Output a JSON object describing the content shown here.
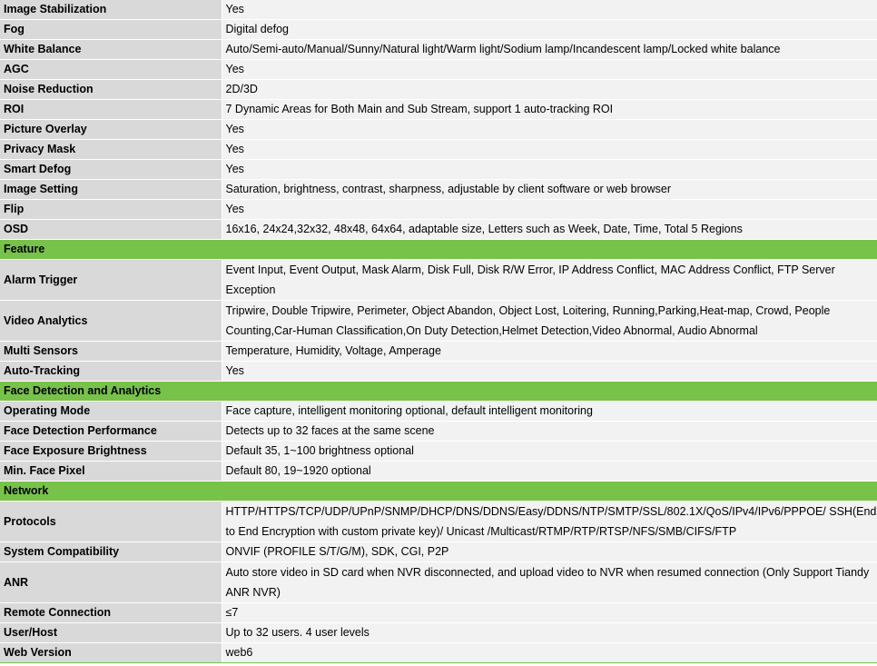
{
  "colors": {
    "section_bg": "#77c248",
    "label_bg": "#d9d9d9",
    "value_bg": "#f2f2f2"
  },
  "rows": [
    {
      "label": "Image Stabilization",
      "value": "Yes"
    },
    {
      "label": "Fog",
      "value": "Digital defog"
    },
    {
      "label": "White Balance",
      "value": "Auto/Semi-auto/Manual/Sunny/Natural light/Warm light/Sodium lamp/Incandescent lamp/Locked white balance"
    },
    {
      "label": "AGC",
      "value": "Yes"
    },
    {
      "label": "Noise Reduction",
      "value": "2D/3D"
    },
    {
      "label": "ROI",
      "value": "7 Dynamic Areas for Both Main and Sub Stream, support 1 auto-tracking ROI"
    },
    {
      "label": "Picture Overlay",
      "value": "Yes"
    },
    {
      "label": "Privacy Mask",
      "value": "Yes"
    },
    {
      "label": "Smart Defog",
      "value": "Yes"
    },
    {
      "label": "Image Setting",
      "value": "Saturation, brightness, contrast, sharpness, adjustable by client software or web browser"
    },
    {
      "label": "Flip",
      "value": "Yes"
    },
    {
      "label": "OSD",
      "value": "16x16, 24x24,32x32, 48x48, 64x64, adaptable size, Letters such as Week, Date, Time, Total 5 Regions"
    },
    {
      "section": "Feature"
    },
    {
      "label": "Alarm Trigger",
      "value": "Event Input, Event Output, Mask Alarm, Disk Full, Disk R/W Error, IP Address Conflict, MAC Address Conflict, FTP Server Exception",
      "tall": true
    },
    {
      "label": "Video Analytics",
      "value": "Tripwire, Double Tripwire, Perimeter, Object  Abandon, Object Lost, Loitering, Running,Parking,Heat-map, Crowd, People Counting,Car-Human Classification,On Duty Detection,Helmet Detection,Video Abnormal, Audio Abnormal",
      "tall": true
    },
    {
      "label": "Multi Sensors",
      "value": "Temperature, Humidity, Voltage, Amperage"
    },
    {
      "label": "Auto-Tracking",
      "value": "Yes"
    },
    {
      "section": "Face Detection and Analytics"
    },
    {
      "label": "Operating Mode",
      "value": "Face capture, intelligent monitoring optional, default intelligent monitoring"
    },
    {
      "label": "Face Detection Performance",
      "value": "Detects up to 32 faces at the same scene"
    },
    {
      "label": "Face Exposure Brightness",
      "value": "Default 35, 1~100 brightness optional"
    },
    {
      "label": "Min. Face Pixel",
      "value": "Default 80, 19~1920 optional"
    },
    {
      "section": "Network"
    },
    {
      "label": "Protocols",
      "value": "HTTP/HTTPS/TCP/UDP/UPnP/SNMP/DHCP/DNS/DDNS/Easy/DDNS/NTP/SMTP/SSL/802.1X/QoS/IPv4/IPv6/PPPOE/ SSH(End to End Encryption with custom private key)/ Unicast /Multicast/RTMP/RTP/RTSP/NFS/SMB/CIFS/FTP",
      "tall": true
    },
    {
      "label": "System Compatibility",
      "value": "ONVIF (PROFILE S/T/G/M), SDK, CGI, P2P"
    },
    {
      "label": "ANR",
      "value": "Auto store video in SD card when NVR disconnected, and upload video to NVR when resumed connection (Only Support Tiandy ANR NVR)",
      "tall": true
    },
    {
      "label": "Remote Connection",
      "value": "≤7"
    },
    {
      "label": "User/Host",
      "value": "Up to 32 users. 4 user levels"
    },
    {
      "label": "Web Version",
      "value": "web6"
    }
  ]
}
